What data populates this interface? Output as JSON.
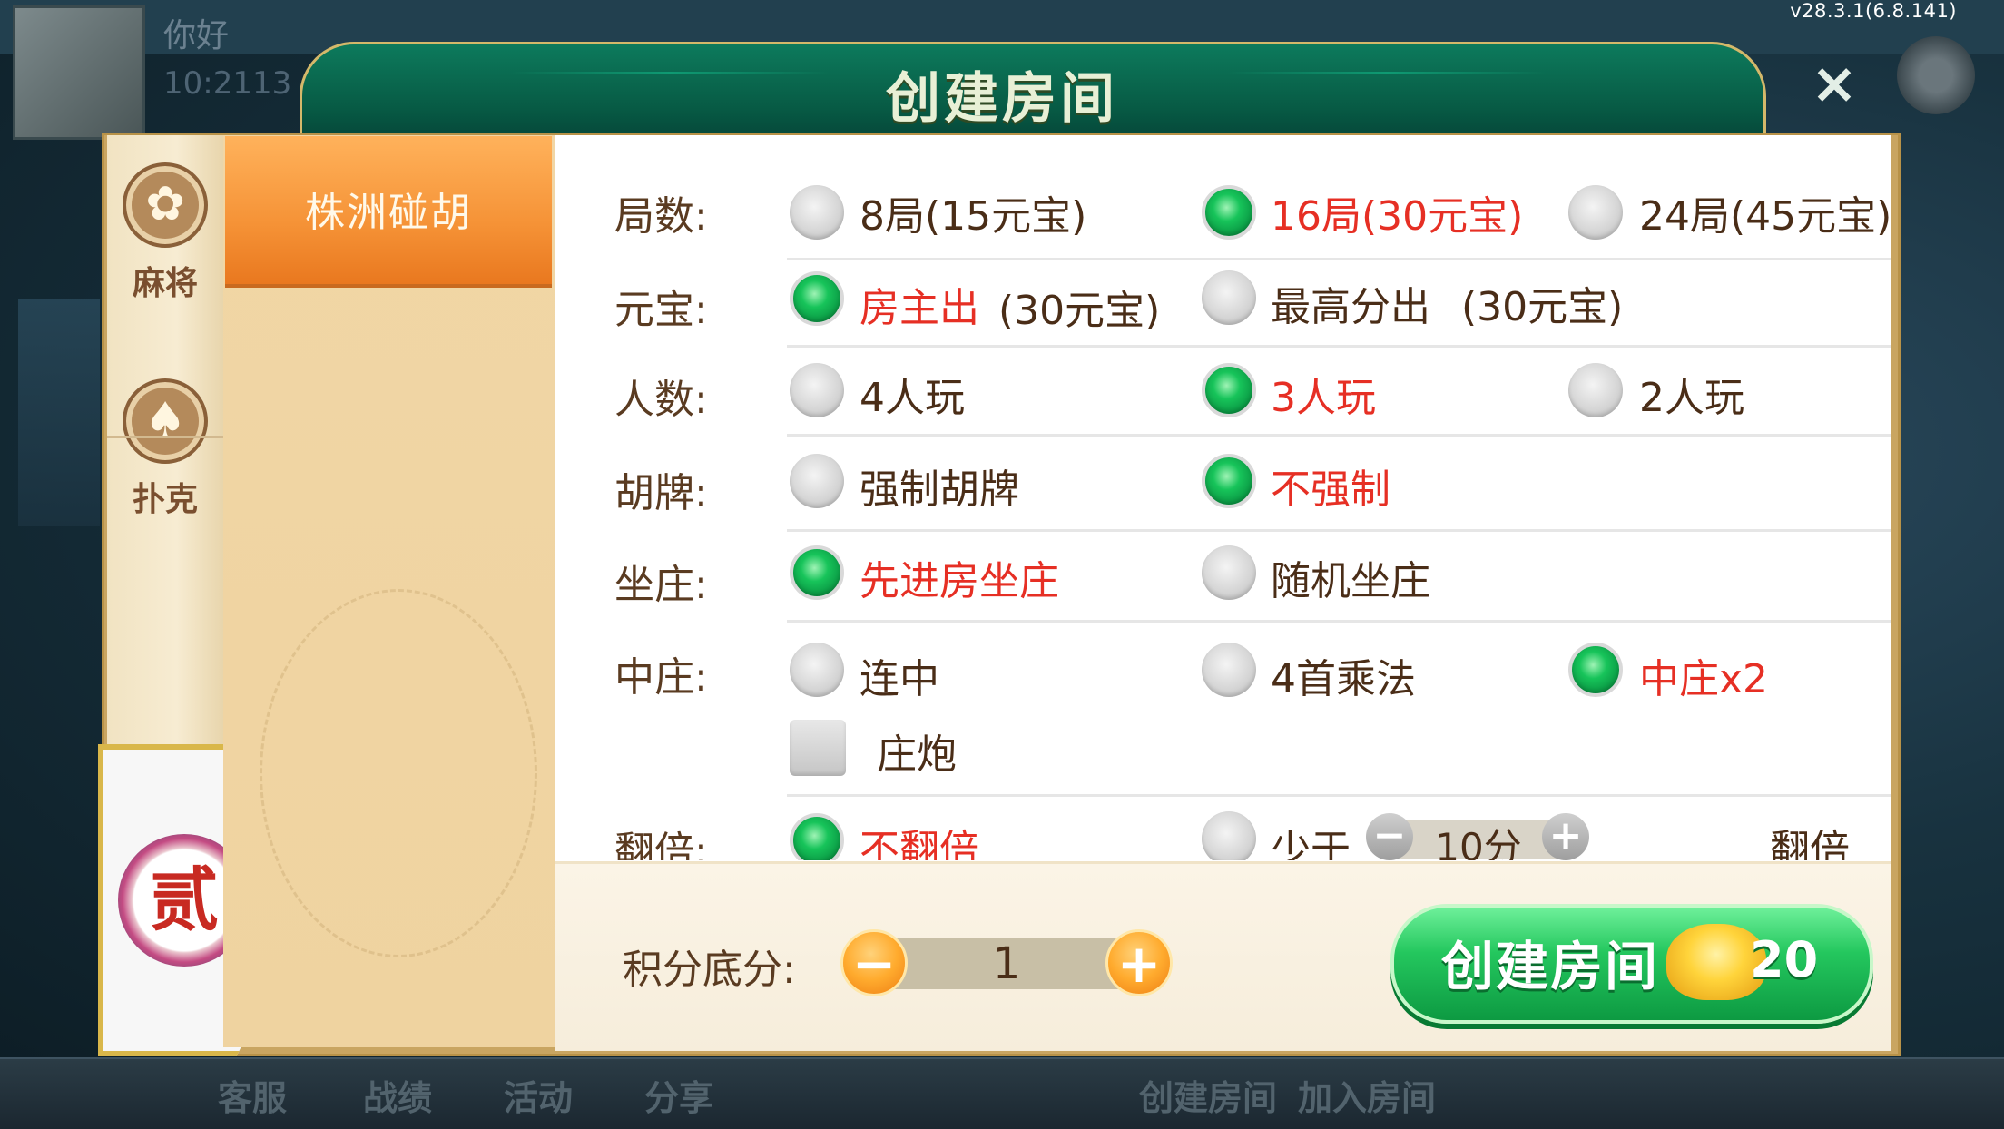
{
  "version": "v28.3.1(6.8.141)",
  "background": {
    "greeting": "你好",
    "user_id": "10:2113",
    "bottom_nav": [
      "客服",
      "战绩",
      "活动",
      "分享",
      "创建房间",
      "加入房间"
    ]
  },
  "dialog": {
    "title": "创建房间",
    "close_icon": "close-icon",
    "categories": [
      {
        "label": "麻将",
        "icon": "mahjong-icon"
      },
      {
        "label": "扑克",
        "icon": "spade-icon"
      },
      {
        "label": "贰",
        "icon": "er-badge-icon"
      }
    ],
    "games": [
      "株洲碰胡"
    ],
    "options": {
      "rounds": {
        "label": "局数:",
        "choices": [
          "8局(15元宝)",
          "16局(30元宝)",
          "24局(45元宝)"
        ],
        "selected": 1
      },
      "payment": {
        "label": "元宝:",
        "choices": [
          "房主出",
          "最高分出"
        ],
        "costs": [
          "(30元宝)",
          "(30元宝)"
        ],
        "selected": 0
      },
      "players": {
        "label": "人数:",
        "choices": [
          "4人玩",
          "3人玩",
          "2人玩"
        ],
        "selected": 1
      },
      "hupai": {
        "label": "胡牌:",
        "choices": [
          "强制胡牌",
          "不强制"
        ],
        "selected": 1
      },
      "dealer": {
        "label": "坐庄:",
        "choices": [
          "先进房坐庄",
          "随机坐庄"
        ],
        "selected": 0
      },
      "zhongzhuang": {
        "label": "中庄:",
        "choices": [
          "连中",
          "4首乘法",
          "中庄x2"
        ],
        "selected": 2,
        "checkbox": "庄炮",
        "checkbox_checked": false
      },
      "double": {
        "label": "翻倍:",
        "choices": [
          "不翻倍",
          "少于"
        ],
        "selected": 0,
        "stepper_value": "10分",
        "suffix": "翻倍"
      }
    },
    "footer": {
      "score_label": "积分底分:",
      "score_value": "1",
      "minus": "−",
      "plus": "+",
      "create_label": "创建房间",
      "create_cost": "20"
    }
  },
  "colors": {
    "accent_green": "#17c45a",
    "selected_text": "#e62f24",
    "header_green": "#075a44",
    "orange": "#f59236"
  }
}
